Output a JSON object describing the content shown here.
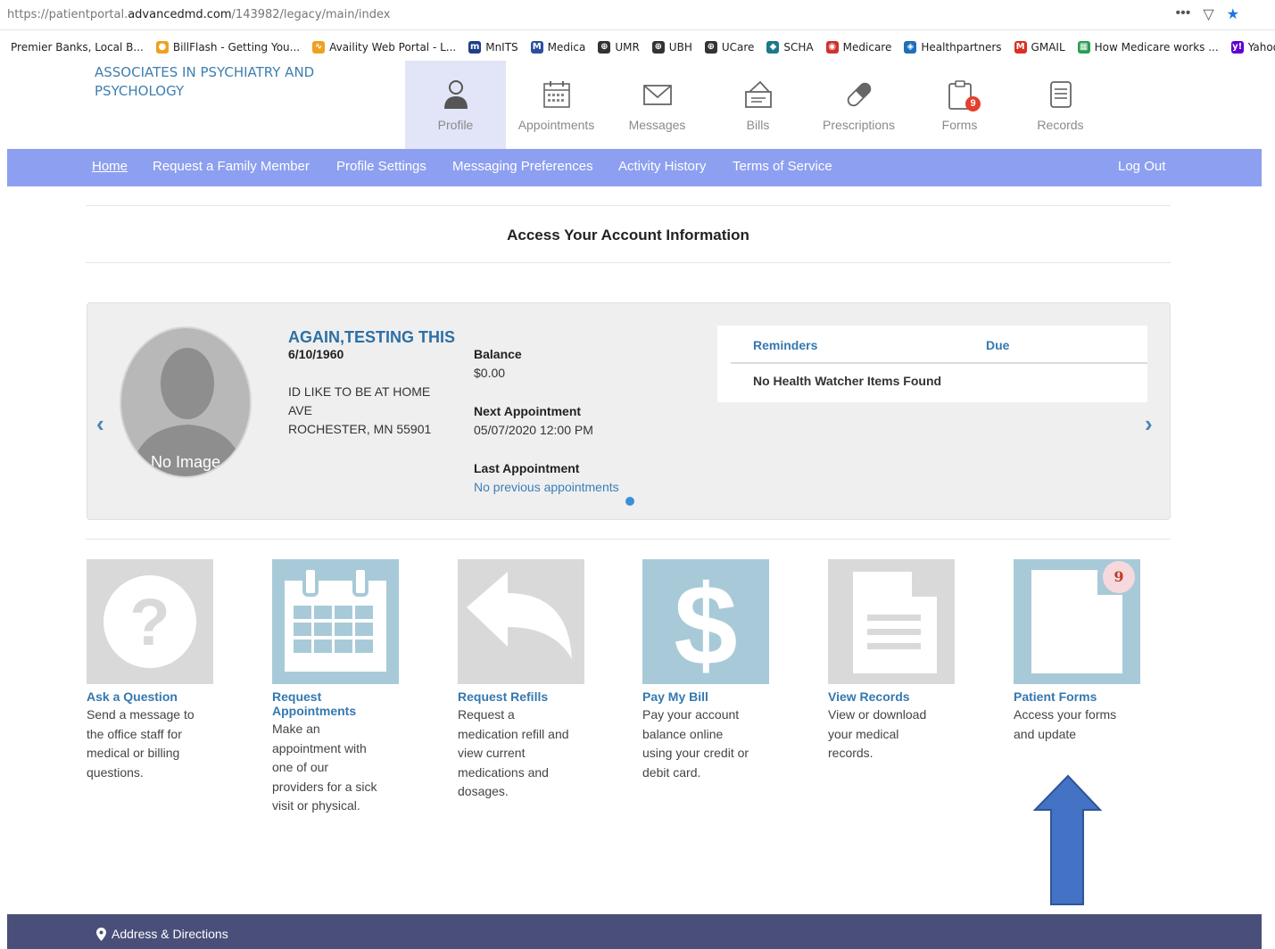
{
  "browser": {
    "url_prefix": "https://patientportal.",
    "url_domain": "advancedmd.com",
    "url_path": "/143982/legacy/main/index",
    "bookmarks": [
      {
        "label": "Premier Banks, Local B...",
        "icon": "",
        "color": ""
      },
      {
        "label": "BillFlash - Getting You...",
        "icon": "●",
        "color": "#f0a020"
      },
      {
        "label": "Availity Web Portal - L...",
        "icon": "∿",
        "color": "#f0a020"
      },
      {
        "label": "MnITS",
        "icon": "m",
        "color": "#1e3f8a"
      },
      {
        "label": "Medica",
        "icon": "M",
        "color": "#2c4fa0"
      },
      {
        "label": "UMR",
        "icon": "⊕",
        "color": "#333333"
      },
      {
        "label": "UBH",
        "icon": "⊕",
        "color": "#333333"
      },
      {
        "label": "UCare",
        "icon": "⊕",
        "color": "#333333"
      },
      {
        "label": "SCHA",
        "icon": "◆",
        "color": "#1b7a8a"
      },
      {
        "label": "Medicare",
        "icon": "◉",
        "color": "#d0312d"
      },
      {
        "label": "Healthpartners",
        "icon": "◈",
        "color": "#1d6fb8"
      },
      {
        "label": "GMAIL",
        "icon": "M",
        "color": "#d93025"
      },
      {
        "label": "How Medicare works ...",
        "icon": "▦",
        "color": "#2a9d55"
      },
      {
        "label": "Yahoo -",
        "icon": "y!",
        "color": "#6001d2"
      }
    ]
  },
  "brand": {
    "name": "ASSOCIATES IN PSYCHIATRY AND PSYCHOLOGY"
  },
  "topnav": {
    "tabs": [
      {
        "label": "Profile",
        "icon": "profile-icon",
        "active": true
      },
      {
        "label": "Appointments",
        "icon": "calendar-icon"
      },
      {
        "label": "Messages",
        "icon": "envelope-icon"
      },
      {
        "label": "Bills",
        "icon": "wallet-icon"
      },
      {
        "label": "Prescriptions",
        "icon": "pill-icon"
      },
      {
        "label": "Forms",
        "icon": "clipboard-icon",
        "badge": "9"
      },
      {
        "label": "Records",
        "icon": "document-icon"
      }
    ]
  },
  "subnav": {
    "items": [
      "Home",
      "Request a Family Member",
      "Profile Settings",
      "Messaging Preferences",
      "Activity History",
      "Terms of Service"
    ],
    "logout": "Log Out"
  },
  "main": {
    "heading": "Access Your Account Information"
  },
  "patient": {
    "avatar_text": "No Image Available",
    "name": "AGAIN,TESTING THIS",
    "dob": "6/10/1960",
    "address_line1": "ID LIKE TO BE AT HOME",
    "address_line2": "AVE",
    "address_line3": "ROCHESTER, MN 55901",
    "balance_label": "Balance",
    "balance_value": "$0.00",
    "next_label": "Next Appointment",
    "next_value": "05/07/2020 12:00 PM",
    "last_label": "Last Appointment",
    "last_value": "No previous appointments"
  },
  "reminders": {
    "col1": "Reminders",
    "col2": "Due",
    "empty": "No Health Watcher Items Found"
  },
  "tiles": [
    {
      "title": "Ask a Question",
      "desc": [
        "Send a message to",
        "the office staff for",
        "medical or billing",
        "questions."
      ],
      "icon": "question-icon",
      "bg": "#d9d9d9"
    },
    {
      "title": "Request Appointments",
      "desc": [
        "Make an",
        "appointment with",
        "one of our",
        "providers for a sick",
        "visit or physical."
      ],
      "icon": "calendar-icon",
      "bg": "#a8cad8"
    },
    {
      "title": "Request Refills",
      "desc": [
        "Request a",
        "medication refill and",
        "view current",
        "medications and",
        "dosages."
      ],
      "icon": "reply-arrow-icon",
      "bg": "#d9d9d9"
    },
    {
      "title": "Pay My Bill",
      "desc": [
        "Pay your account",
        "balance online",
        "using your credit or",
        "debit card."
      ],
      "icon": "dollar-icon",
      "bg": "#a8cad8"
    },
    {
      "title": "View Records",
      "desc": [
        "View or download",
        "your medical",
        "records."
      ],
      "icon": "document-icon",
      "bg": "#d9d9d9"
    },
    {
      "title": "Patient Forms",
      "desc": [
        "Access your forms",
        "and update"
      ],
      "icon": "form-icon",
      "bg": "#a8cad8",
      "badge": "9"
    }
  ],
  "footer": {
    "address": "Address & Directions"
  },
  "colors": {
    "accent": "#8d9ff0",
    "link": "#3478b0",
    "footer": "#4a4f7a",
    "annotation_arrow": "#4472c4"
  }
}
